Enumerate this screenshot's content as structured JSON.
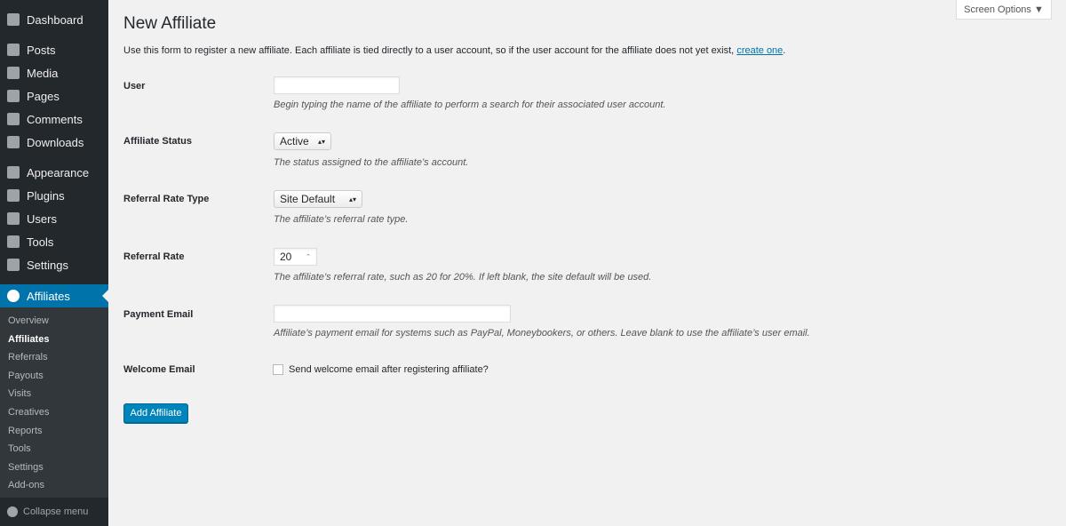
{
  "sidebar": {
    "items": [
      {
        "label": "Dashboard",
        "icon": "dashboard-icon"
      },
      {
        "label": "Posts",
        "icon": "pin-icon"
      },
      {
        "label": "Media",
        "icon": "media-icon"
      },
      {
        "label": "Pages",
        "icon": "pages-icon"
      },
      {
        "label": "Comments",
        "icon": "comment-icon"
      },
      {
        "label": "Downloads",
        "icon": "download-icon"
      },
      {
        "label": "Appearance",
        "icon": "brush-icon"
      },
      {
        "label": "Plugins",
        "icon": "plug-icon"
      },
      {
        "label": "Users",
        "icon": "user-icon"
      },
      {
        "label": "Tools",
        "icon": "wrench-icon"
      },
      {
        "label": "Settings",
        "icon": "settings-icon"
      },
      {
        "label": "Affiliates",
        "icon": "affiliates-icon"
      }
    ],
    "submenu": [
      "Overview",
      "Affiliates",
      "Referrals",
      "Payouts",
      "Visits",
      "Creatives",
      "Reports",
      "Tools",
      "Settings",
      "Add-ons"
    ],
    "collapse": "Collapse menu"
  },
  "screen_options": "Screen Options ▼",
  "title": "New Affiliate",
  "intro": "Use this form to register a new affiliate. Each affiliate is tied directly to a user account, so if the user account for the affiliate does not yet exist, ",
  "intro_link": "create one",
  "intro_end": ".",
  "form": {
    "user": {
      "label": "User",
      "value": "",
      "desc": "Begin typing the name of the affiliate to perform a search for their associated user account."
    },
    "status": {
      "label": "Affiliate Status",
      "value": "Active",
      "desc": "The status assigned to the affiliate’s account."
    },
    "rate_type": {
      "label": "Referral Rate Type",
      "value": "Site Default",
      "desc": "The affiliate’s referral rate type."
    },
    "rate": {
      "label": "Referral Rate",
      "value": "20",
      "desc": "The affiliate’s referral rate, such as 20 for 20%. If left blank, the site default will be used."
    },
    "email": {
      "label": "Payment Email",
      "value": "",
      "desc": "Affiliate’s payment email for systems such as PayPal, Moneybookers, or others. Leave blank to use the affiliate’s user email."
    },
    "welcome": {
      "label": "Welcome Email",
      "checkbox": "Send welcome email after registering affiliate?",
      "checked": false
    },
    "submit": "Add Affiliate"
  },
  "colors": {
    "sidebar": "#23282d",
    "accent": "#0073aa",
    "button": "#0085ba"
  }
}
